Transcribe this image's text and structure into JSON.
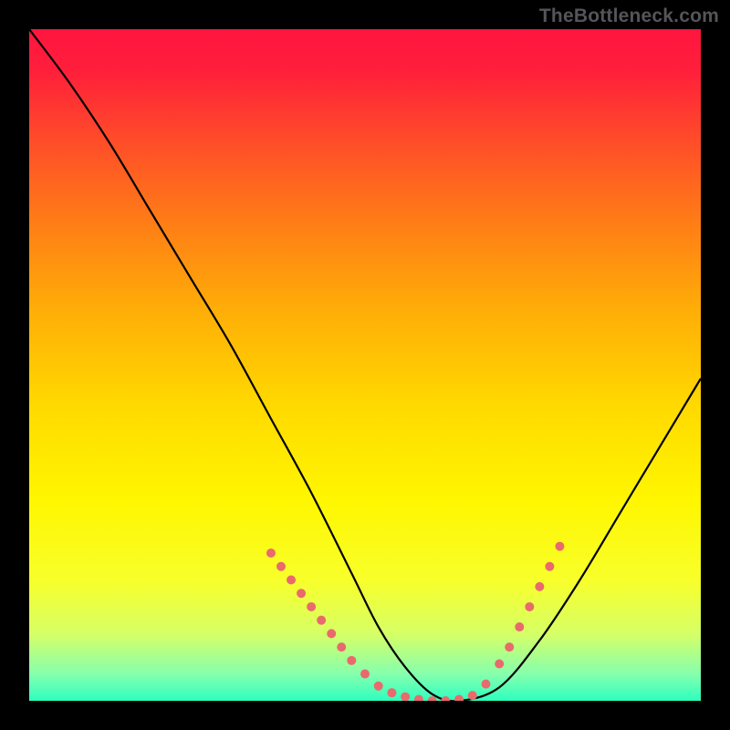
{
  "watermark": "TheBottleneck.com",
  "chart_data": {
    "type": "line",
    "title": "",
    "xlabel": "",
    "ylabel": "",
    "xlim": [
      0,
      100
    ],
    "ylim": [
      0,
      100
    ],
    "grid": false,
    "legend": false,
    "gradient_stops": [
      {
        "offset": 0.0,
        "color": "#ff163f"
      },
      {
        "offset": 0.06,
        "color": "#ff1e3b"
      },
      {
        "offset": 0.16,
        "color": "#ff4a2a"
      },
      {
        "offset": 0.28,
        "color": "#ff7a17"
      },
      {
        "offset": 0.42,
        "color": "#ffae07"
      },
      {
        "offset": 0.56,
        "color": "#ffd900"
      },
      {
        "offset": 0.7,
        "color": "#fff600"
      },
      {
        "offset": 0.82,
        "color": "#f8ff2a"
      },
      {
        "offset": 0.9,
        "color": "#d6ff66"
      },
      {
        "offset": 0.96,
        "color": "#86ffad"
      },
      {
        "offset": 1.0,
        "color": "#2dffbf"
      }
    ],
    "series": [
      {
        "name": "curve",
        "x": [
          0,
          6,
          12,
          18,
          24,
          30,
          36,
          42,
          48,
          52,
          56,
          60,
          64,
          70,
          76,
          82,
          88,
          94,
          100
        ],
        "y": [
          100,
          92,
          83,
          73,
          63,
          53,
          42,
          31,
          19,
          11,
          5,
          1,
          0,
          2,
          9,
          18,
          28,
          38,
          48
        ]
      }
    ],
    "markers": {
      "name": "dotted-segments",
      "color": "#e96a6d",
      "points": [
        {
          "x": 36,
          "y": 22
        },
        {
          "x": 37.5,
          "y": 20
        },
        {
          "x": 39,
          "y": 18
        },
        {
          "x": 40.5,
          "y": 16
        },
        {
          "x": 42,
          "y": 14
        },
        {
          "x": 43.5,
          "y": 12
        },
        {
          "x": 45,
          "y": 10
        },
        {
          "x": 46.5,
          "y": 8
        },
        {
          "x": 48,
          "y": 6
        },
        {
          "x": 50,
          "y": 4
        },
        {
          "x": 52,
          "y": 2.2
        },
        {
          "x": 54,
          "y": 1.2
        },
        {
          "x": 56,
          "y": 0.6
        },
        {
          "x": 58,
          "y": 0.2
        },
        {
          "x": 60,
          "y": 0
        },
        {
          "x": 62,
          "y": 0
        },
        {
          "x": 64,
          "y": 0.2
        },
        {
          "x": 66,
          "y": 0.8
        },
        {
          "x": 68,
          "y": 2.5
        },
        {
          "x": 70,
          "y": 5.5
        },
        {
          "x": 71.5,
          "y": 8
        },
        {
          "x": 73,
          "y": 11
        },
        {
          "x": 74.5,
          "y": 14
        },
        {
          "x": 76,
          "y": 17
        },
        {
          "x": 77.5,
          "y": 20
        },
        {
          "x": 79,
          "y": 23
        }
      ]
    }
  }
}
